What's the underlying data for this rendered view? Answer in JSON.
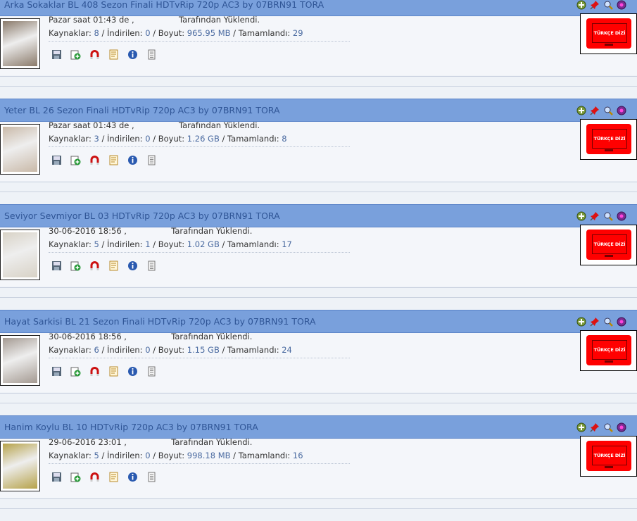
{
  "torrents": [
    {
      "title": "Arka Sokaklar BL 408 Sezon Finali HDTvRip 720p AC3 by 07BRN91 TORA",
      "date": "Pazar saat 01:43 de ,",
      "uploaded": "Tarafından Yüklendi.",
      "seeds_label": "Kaynaklar:",
      "seeds": "8",
      "leech_label": "İndirilen:",
      "leech": "0",
      "size_label": "Boyut:",
      "size": "965.95 MB",
      "done_label": "Tamamlandı:",
      "done": "29",
      "category": "TÜRKÇE DİZİ",
      "thumb_color": "#8a7a6a"
    },
    {
      "title": "Yeter BL 26 Sezon Finali HDTvRip 720p AC3 by 07BRN91 TORA",
      "date": "Pazar saat 01:43 de ,",
      "uploaded": "Tarafından Yüklendi.",
      "seeds_label": "Kaynaklar:",
      "seeds": "3",
      "leech_label": "İndirilen:",
      "leech": "0",
      "size_label": "Boyut:",
      "size": "1.26 GB",
      "done_label": "Tamamlandı:",
      "done": "8",
      "category": "TÜRKÇE DİZİ",
      "thumb_color": "#c9b9a8"
    },
    {
      "title": "Seviyor Sevmiyor BL 03 HDTvRip 720p AC3 by 07BRN91 TORA",
      "date": "30-06-2016 18:56 ,",
      "uploaded": "Tarafından Yüklendi.",
      "seeds_label": "Kaynaklar:",
      "seeds": "5",
      "leech_label": "İndirilen:",
      "leech": "1",
      "size_label": "Boyut:",
      "size": "1.02 GB",
      "done_label": "Tamamlandı:",
      "done": "17",
      "category": "TÜRKÇE DİZİ",
      "thumb_color": "#d8d2c6"
    },
    {
      "title": "Hayat Sarkisi BL 21 Sezon Finali HDTvRip 720p AC3 by 07BRN91 TORA",
      "date": "30-06-2016 18:56 ,",
      "uploaded": "Tarafından Yüklendi.",
      "seeds_label": "Kaynaklar:",
      "seeds": "6",
      "leech_label": "İndirilen:",
      "leech": "0",
      "size_label": "Boyut:",
      "size": "1.15 GB",
      "done_label": "Tamamlandı:",
      "done": "24",
      "category": "TÜRKÇE DİZİ",
      "thumb_color": "#a49a92"
    },
    {
      "title": "Hanim Koylu BL 10 HDTvRip 720p AC3 by 07BRN91 TORA",
      "date": "29-06-2016 23:01 ,",
      "uploaded": "Tarafından Yüklendi.",
      "seeds_label": "Kaynaklar:",
      "seeds": "5",
      "leech_label": "İndirilen:",
      "leech": "0",
      "size_label": "Boyut:",
      "size": "998.18 MB",
      "done_label": "Tamamlandı:",
      "done": "16",
      "category": "TÜRKÇE DİZİ",
      "thumb_color": "#b6a24a"
    }
  ],
  "icon_names": [
    "download-icon",
    "add-icon",
    "magnet-icon",
    "nfo-icon",
    "info-icon",
    "comment-icon"
  ],
  "header_icon_names": [
    "add-favorite-icon",
    "pin-icon",
    "search-icon",
    "ratings-icon"
  ]
}
